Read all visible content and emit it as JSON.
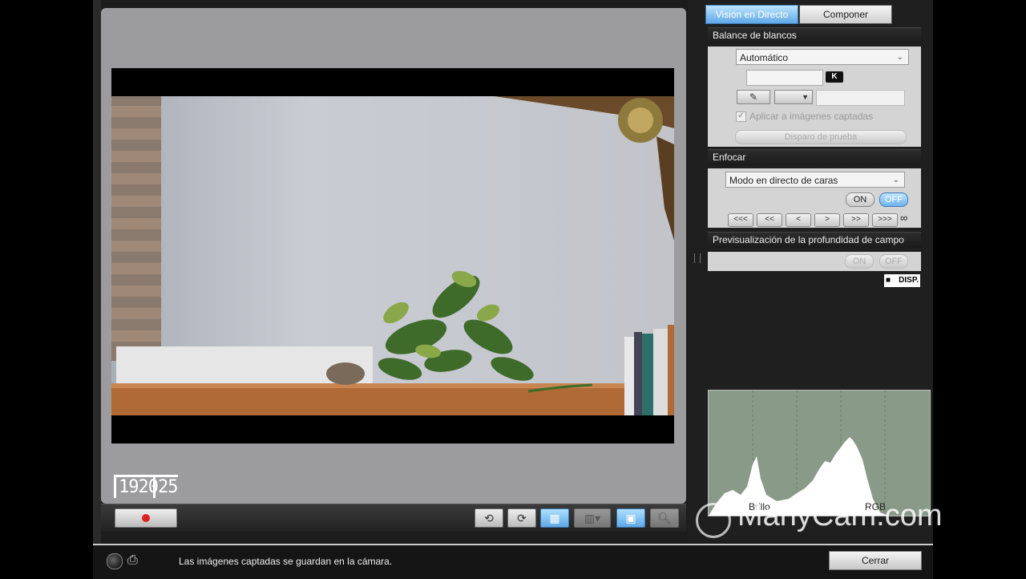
{
  "tabs": {
    "live_view": "Visión en Directo",
    "compose": "Componer"
  },
  "white_balance": {
    "title": "Balance de blancos",
    "mode": "Automático",
    "kelvin_badge": "K",
    "apply_label": "Aplicar a imágenes captadas",
    "test_shot": "Disparo de prueba"
  },
  "focus": {
    "title": "Enfocar",
    "mode": "Modo en directo de caras",
    "on": "ON",
    "off": "OFF",
    "nav": [
      "<<<",
      "<<",
      "<",
      ">",
      ">>",
      ">>>"
    ],
    "infinity": "∞"
  },
  "dof_preview": {
    "title": "Previsualización de la profundidad de campo",
    "on": "ON",
    "off": "OFF"
  },
  "disp_badge": "DISP.",
  "histogram": {
    "brightness": "Brillo",
    "rgb": "RGB"
  },
  "format": {
    "resolution": "1920",
    "frame_rate": "25"
  },
  "status": {
    "message": "Las imágenes captadas se guardan en la cámara.",
    "close": "Cerrar"
  },
  "watermark": "ManyCam.com",
  "colors": {
    "accent_blue": "#5fa8e6",
    "record_red": "#e02020",
    "preview_gray": "#9c9c9e"
  }
}
